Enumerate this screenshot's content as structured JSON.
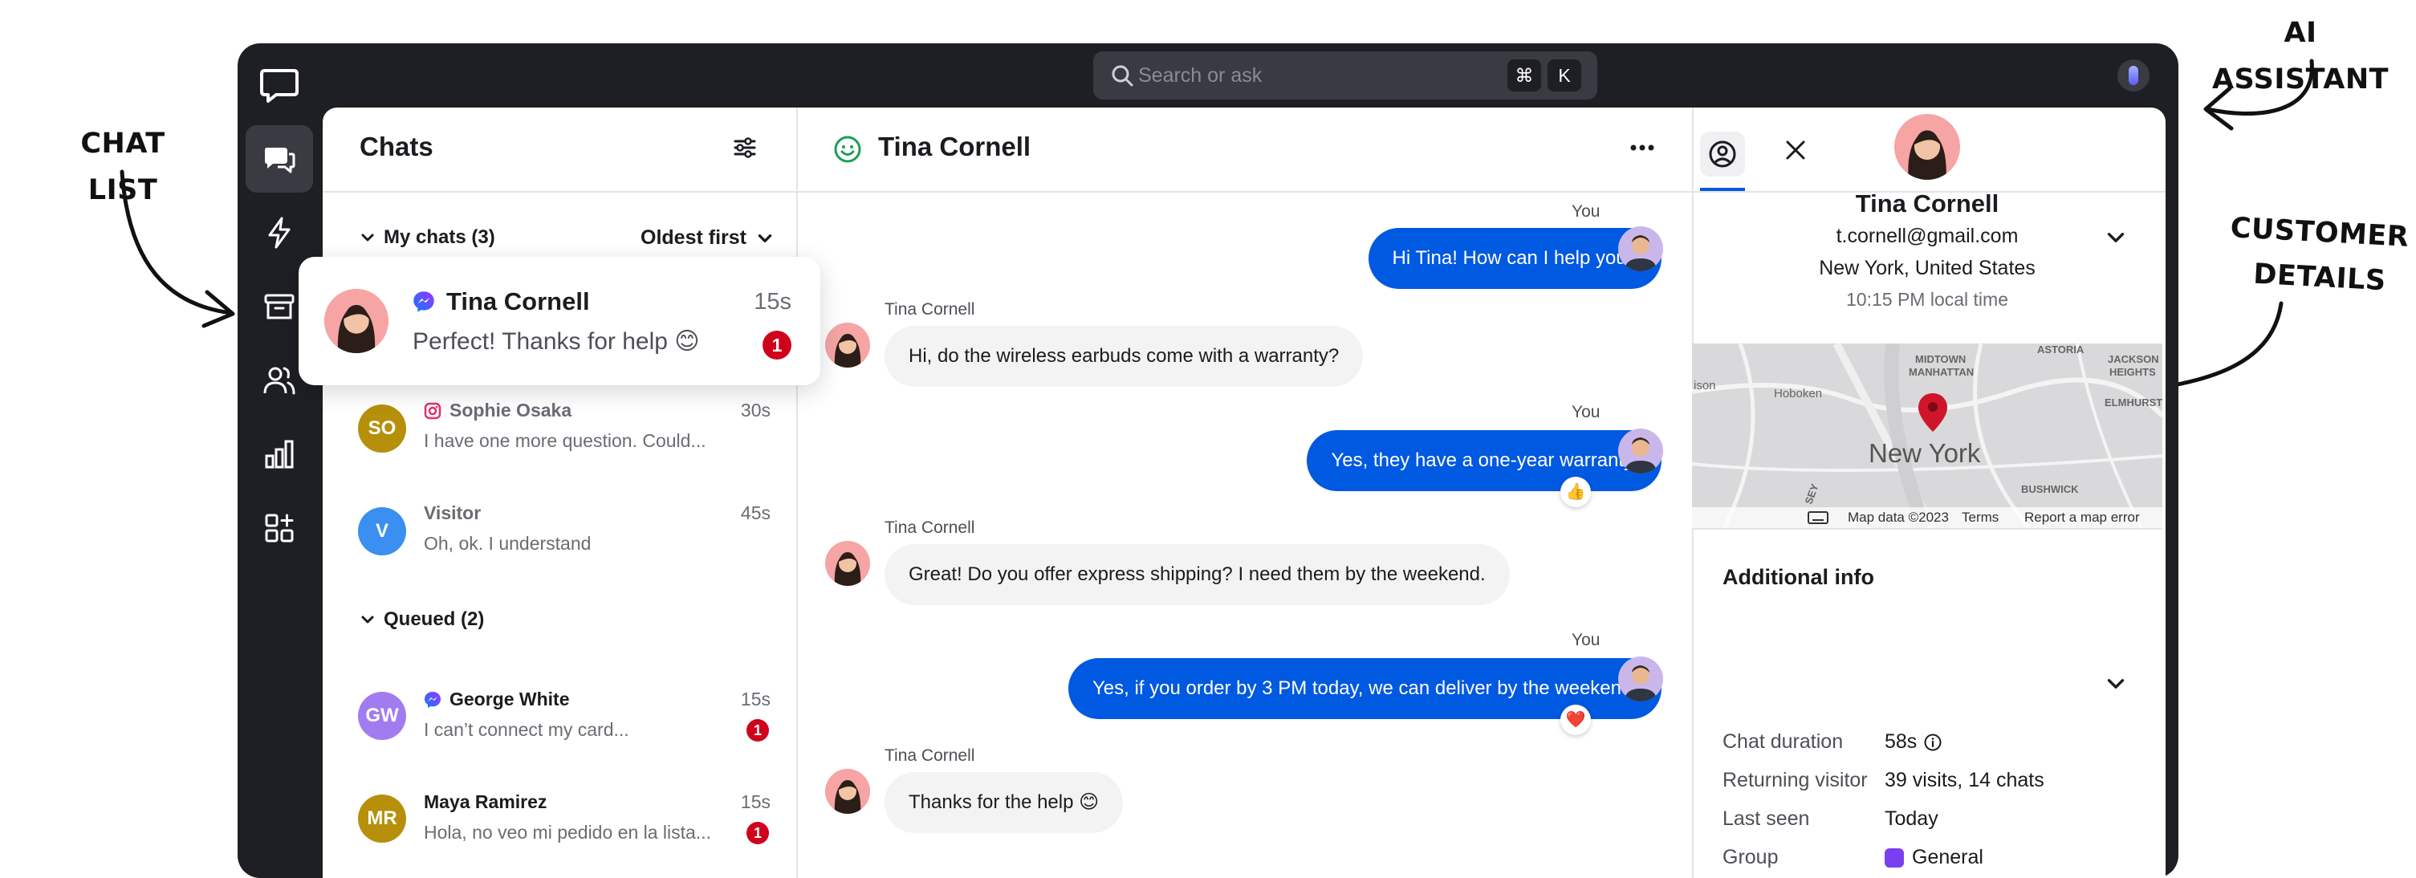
{
  "annotations": {
    "chat_list": "CHAT LIST",
    "ai_assistant": "AI ASSISTANT",
    "customer_details_line1": "CUSTOMER",
    "customer_details_line2": "DETAILS"
  },
  "topbar": {
    "search_placeholder": "Search or ask",
    "shortcut_key1": "⌘",
    "shortcut_key2": "K"
  },
  "nav": {
    "items": [
      "chats-icon",
      "lightning-icon",
      "archive-icon",
      "customers-icon",
      "reports-icon",
      "apps-icon"
    ],
    "active": "chats-icon"
  },
  "chat_list": {
    "title": "Chats",
    "my_chats_label": "My chats (3)",
    "sort_label": "Oldest first",
    "queued_label": "Queued (2)",
    "highlighted": {
      "name": "Tina Cornell",
      "preview": "Perfect! Thanks for help 😊",
      "time": "15s",
      "unread": "1",
      "channel": "messenger-icon"
    },
    "items": [
      {
        "initials": "SO",
        "name": "Sophie Osaka",
        "preview": "I have one more question. Could...",
        "time": "30s",
        "channel": "instagram-icon",
        "avatar_color": "#b6900a"
      },
      {
        "initials": "V",
        "name": "Visitor",
        "preview": "Oh, ok. I understand",
        "time": "45s",
        "avatar_color": "#3a8ff0"
      }
    ],
    "queued": [
      {
        "initials": "GW",
        "name": "George White",
        "preview": "I can’t connect my card...",
        "time": "15s",
        "unread": "1",
        "channel": "messenger-icon",
        "avatar_color": "#a07cf0"
      },
      {
        "initials": "MR",
        "name": "Maya Ramirez",
        "preview": "Hola, no veo mi pedido en la lista...",
        "time": "15s",
        "unread": "1",
        "avatar_color": "#b6900a"
      }
    ]
  },
  "conversation": {
    "customer_name": "Tina Cornell",
    "you_label": "You",
    "messages": [
      {
        "from": "agent",
        "text": "Hi Tina! How can I help you?"
      },
      {
        "from": "customer",
        "author": "Tina Cornell",
        "text": "Hi, do the wireless earbuds come with a warranty?"
      },
      {
        "from": "agent",
        "text": "Yes, they have a one-year warranty.",
        "reaction": "👍"
      },
      {
        "from": "customer",
        "author": "Tina Cornell",
        "text": "Great! Do you offer express shipping? I need them by the weekend."
      },
      {
        "from": "agent",
        "text": "Yes, if you order by 3 PM today, we can deliver by the weekend.",
        "reaction": "❤️"
      },
      {
        "from": "customer",
        "author": "Tina Cornell",
        "text": "Thanks for the help 😊"
      }
    ]
  },
  "customer": {
    "name": "Tina Cornell",
    "email": "t.cornell@gmail.com",
    "location": "New York, United States",
    "local_time": "10:15 PM local time",
    "map": {
      "city": "New York",
      "labels": [
        "MIDTOWN",
        "MANHATTAN",
        "ASTORIA",
        "JACKSON",
        "HEIGHTS",
        "ELMHURST",
        "Hoboken",
        "ison",
        "BUSHWICK",
        "SEY"
      ],
      "data_credit": "Map data ©2023",
      "terms": "Terms",
      "report": "Report a map error"
    },
    "additional_info_title": "Additional info",
    "info": [
      {
        "label": "Chat duration",
        "value": "58s"
      },
      {
        "label": "Returning visitor",
        "value": "39 visits, 14 chats"
      },
      {
        "label": "Last seen",
        "value": "Today"
      },
      {
        "label": "Group",
        "value": "General"
      }
    ]
  },
  "colors": {
    "frame": "#1e1f24",
    "agent_bubble": "#0059e1",
    "badge": "#d0021b",
    "online": "#1f9d55"
  }
}
